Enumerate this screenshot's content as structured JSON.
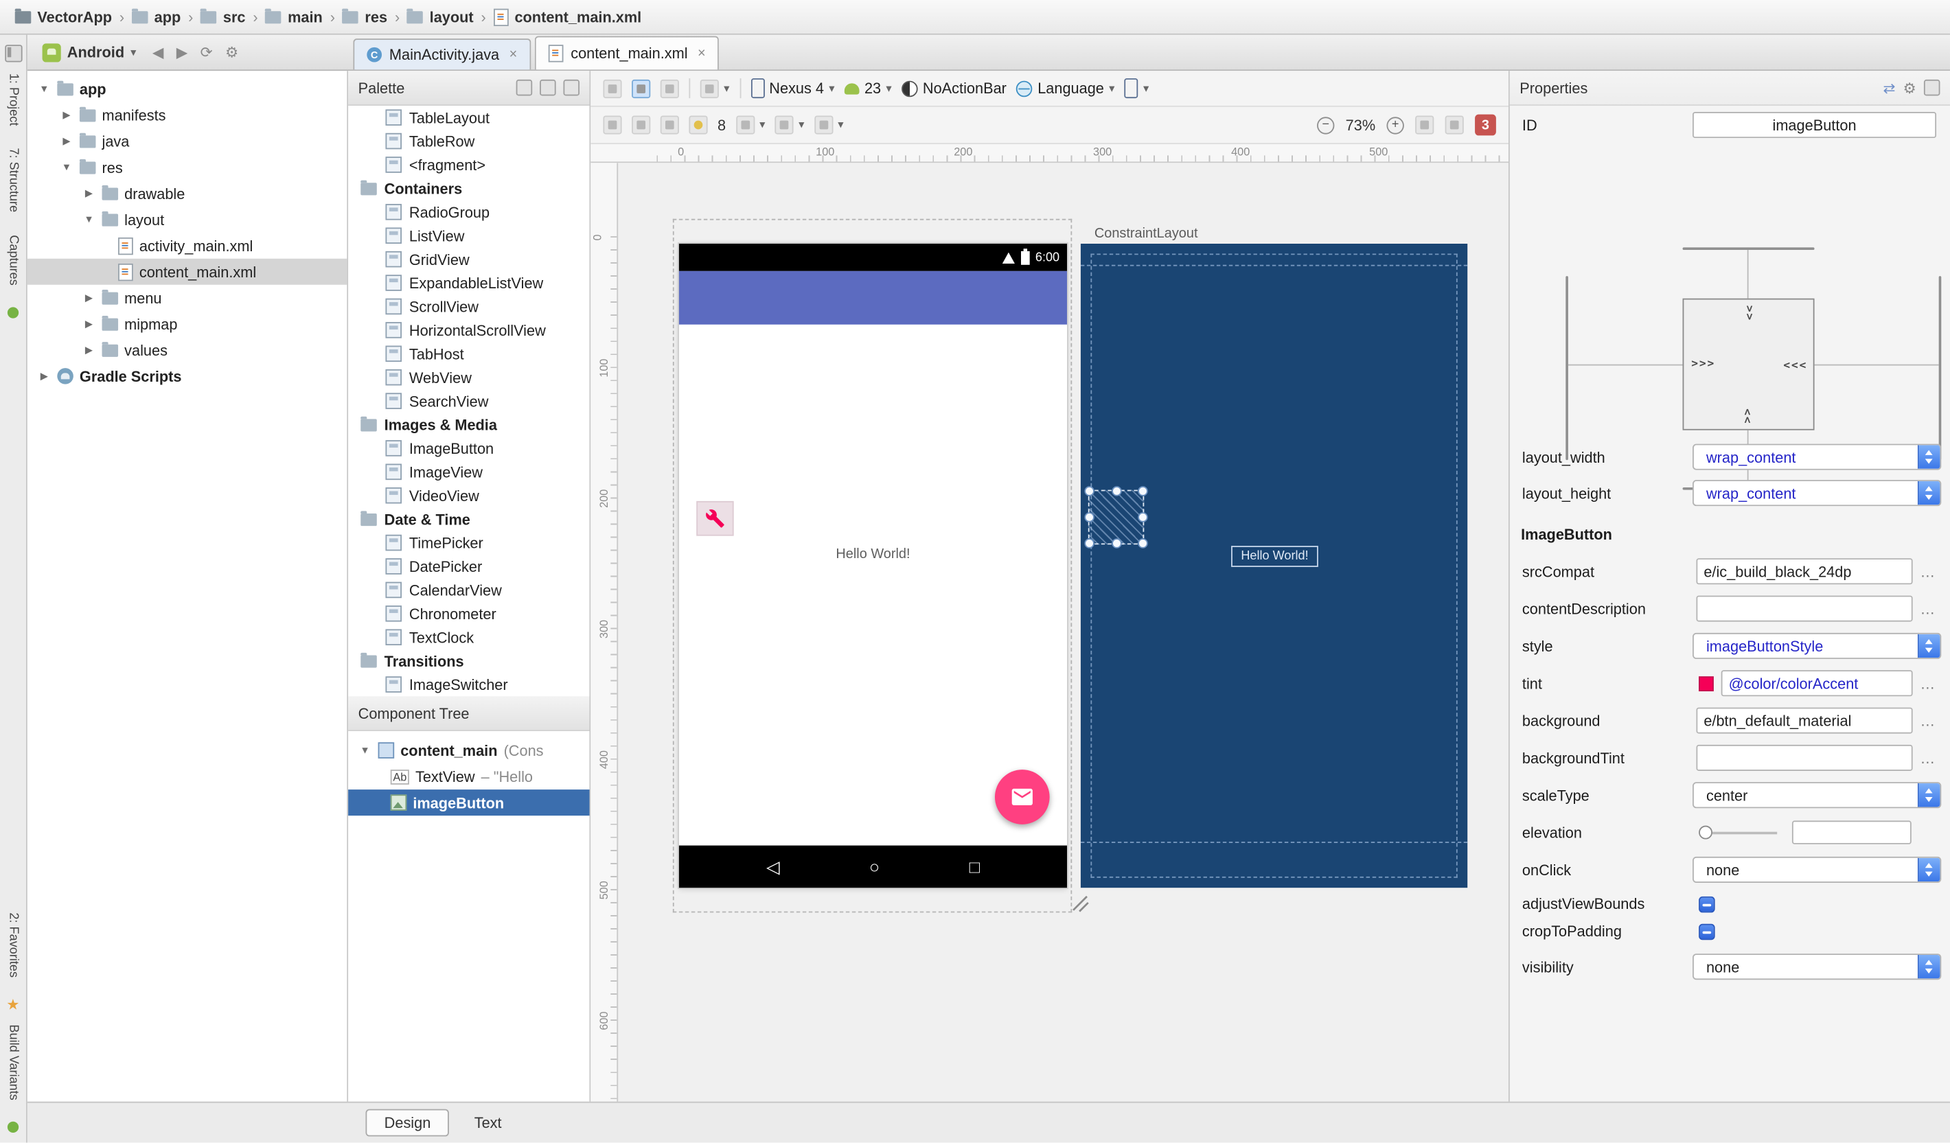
{
  "colors": {
    "accent": "#FF4081",
    "tint_swatch": "#F50057",
    "appbar": "#5C6BC0",
    "blueprint_bg": "#1A4573",
    "error_badge": "#C75450",
    "selection_blue": "#3B6EAE",
    "android_green": "#9BC24C"
  },
  "icons": {
    "sep": "›",
    "dd": "▾",
    "close": "×",
    "expanded": "▼",
    "collapsed": "▶",
    "back": "◀",
    "forward": "▶",
    "sync": "⟳",
    "gear": "⚙",
    "swap": "⇄",
    "dots": "…",
    "gt2": ">>",
    "gt3": ">>>",
    "nav_back": "◁",
    "nav_home": "○",
    "nav_recent": "□",
    "class_c": "C",
    "ab": "Ab",
    "minus": "−",
    "plus": "+",
    "star": "★"
  },
  "breadcrumbs": {
    "items": [
      "VectorApp",
      "app",
      "src",
      "main",
      "res",
      "layout",
      "content_main.xml"
    ]
  },
  "run_config": {
    "label": "Android"
  },
  "editor_tabs": {
    "tabs": [
      {
        "label": "MainActivity.java"
      },
      {
        "label": "content_main.xml"
      }
    ]
  },
  "left_strip": {
    "items": [
      "1: Project",
      "7: Structure",
      "Captures",
      "2: Favorites",
      "Build Variants"
    ]
  },
  "project_tree": {
    "items": [
      {
        "label": "app"
      },
      {
        "label": "manifests"
      },
      {
        "label": "java"
      },
      {
        "label": "res"
      },
      {
        "label": "drawable"
      },
      {
        "label": "layout"
      },
      {
        "label": "activity_main.xml"
      },
      {
        "label": "content_main.xml"
      },
      {
        "label": "menu"
      },
      {
        "label": "mipmap"
      },
      {
        "label": "values"
      },
      {
        "label": "Gradle Scripts"
      }
    ]
  },
  "palette": {
    "title": "Palette",
    "items": [
      {
        "label": "TableLayout"
      },
      {
        "label": "TableRow"
      },
      {
        "label": "<fragment>"
      },
      {
        "label": "Containers"
      },
      {
        "label": "RadioGroup"
      },
      {
        "label": "ListView"
      },
      {
        "label": "GridView"
      },
      {
        "label": "ExpandableListView"
      },
      {
        "label": "ScrollView"
      },
      {
        "label": "HorizontalScrollView"
      },
      {
        "label": "TabHost"
      },
      {
        "label": "WebView"
      },
      {
        "label": "SearchView"
      },
      {
        "label": "Images & Media"
      },
      {
        "label": "ImageButton"
      },
      {
        "label": "ImageView"
      },
      {
        "label": "VideoView"
      },
      {
        "label": "Date & Time"
      },
      {
        "label": "TimePicker"
      },
      {
        "label": "DatePicker"
      },
      {
        "label": "CalendarView"
      },
      {
        "label": "Chronometer"
      },
      {
        "label": "TextClock"
      },
      {
        "label": "Transitions"
      },
      {
        "label": "ImageSwitcher"
      }
    ]
  },
  "component_tree": {
    "title": "Component Tree",
    "items": [
      {
        "name": "content_main",
        "suffix": "(Cons"
      },
      {
        "name": "TextView",
        "suffix": "– \"Hello"
      },
      {
        "name": "imageButton",
        "suffix": ""
      }
    ]
  },
  "design_toolbar": {
    "device": "Nexus 4",
    "api_level": "23",
    "theme": "NoActionBar",
    "locale": "Language",
    "default_margin": "8",
    "zoom": "73%",
    "error_count": "3"
  },
  "canvas": {
    "ruler_h": [
      "0",
      "100",
      "200",
      "300",
      "400",
      "500"
    ],
    "ruler_v": [
      "0",
      "100",
      "200",
      "300",
      "400",
      "500",
      "600"
    ],
    "design_preview": {
      "status_time": "6:00",
      "text": "Hello World!"
    },
    "blueprint_preview": {
      "root_label": "ConstraintLayout",
      "text": "Hello World!"
    }
  },
  "properties": {
    "title": "Properties",
    "id_label": "ID",
    "id_value": "imageButton",
    "section": "ImageButton",
    "layout_width": {
      "label": "layout_width",
      "value": "wrap_content"
    },
    "layout_height": {
      "label": "layout_height",
      "value": "wrap_content"
    },
    "srcCompat": {
      "label": "srcCompat",
      "value": "e/ic_build_black_24dp"
    },
    "contentDescription": {
      "label": "contentDescription",
      "value": ""
    },
    "style": {
      "label": "style",
      "value": "imageButtonStyle"
    },
    "tint": {
      "label": "tint",
      "value": "@color/colorAccent"
    },
    "background": {
      "label": "background",
      "value": "e/btn_default_material"
    },
    "backgroundTint": {
      "label": "backgroundTint",
      "value": ""
    },
    "scaleType": {
      "label": "scaleType",
      "value": "center"
    },
    "elevation": {
      "label": "elevation",
      "value": ""
    },
    "onClick": {
      "label": "onClick",
      "value": "none"
    },
    "adjustViewBounds": {
      "label": "adjustViewBounds"
    },
    "cropToPadding": {
      "label": "cropToPadding"
    },
    "visibility": {
      "label": "visibility",
      "value": "none"
    }
  },
  "bottom_bar": {
    "design": "Design",
    "text": "Text"
  }
}
